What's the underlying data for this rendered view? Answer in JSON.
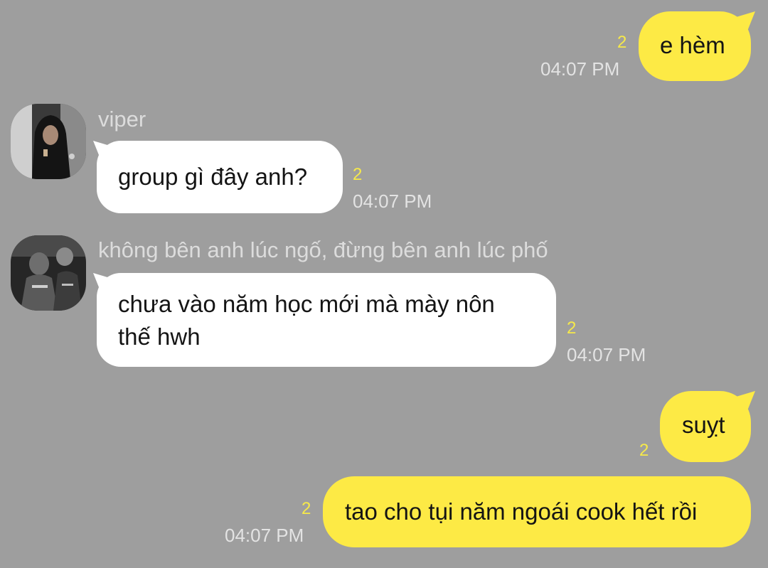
{
  "colors": {
    "background": "#9e9e9e",
    "outgoing_bubble": "#fdea45",
    "incoming_bubble": "#ffffff",
    "unread_count": "#f6e94a",
    "meta_text": "#e3e3e3"
  },
  "messages": [
    {
      "direction": "outgoing",
      "text": "e hèm",
      "unread": "2",
      "time": "04:07 PM"
    },
    {
      "direction": "incoming",
      "sender": "viper",
      "avatar_icon": "hooded-person-avatar",
      "text": "group gì đây anh?",
      "unread": "2",
      "time": "04:07 PM"
    },
    {
      "direction": "incoming",
      "sender": "không bên anh lúc ngố, đừng bên anh lúc phố",
      "avatar_icon": "gamer-group-avatar",
      "text_lines": [
        "chưa vào năm học mới mà mày nôn",
        "thế hwh"
      ],
      "unread": "2",
      "time": "04:07 PM"
    },
    {
      "direction": "outgoing",
      "text": "suỵt",
      "unread": "2"
    },
    {
      "direction": "outgoing",
      "text": "tao cho tụi năm ngoái cook hết rồi",
      "unread": "2",
      "time": "04:07 PM"
    }
  ]
}
